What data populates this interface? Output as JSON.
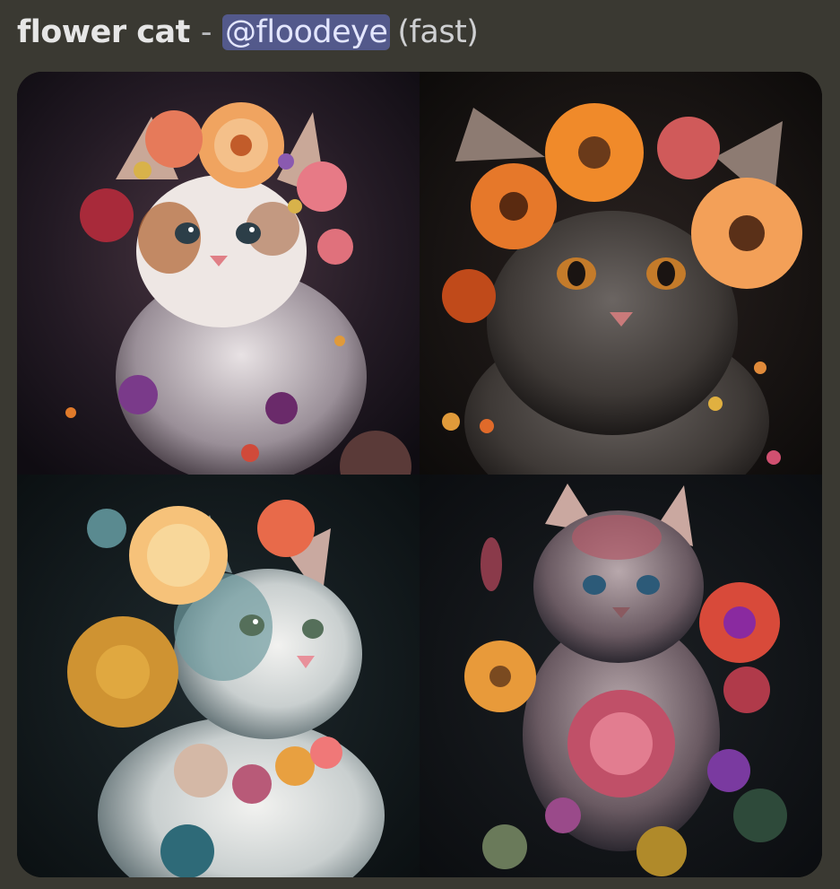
{
  "message": {
    "prompt": "flower cat",
    "separator": "-",
    "mention": "@floodeye",
    "mode": "(fast)"
  },
  "images": [
    {
      "name": "flower-cat-image-1",
      "subject": "calico kitten with pink and orange flower crown"
    },
    {
      "name": "flower-cat-image-2",
      "subject": "dark grey kitten with orange daisies"
    },
    {
      "name": "flower-cat-image-3",
      "subject": "white and teal cat with peach and mustard flowers"
    },
    {
      "name": "flower-cat-image-4",
      "subject": "fluffy kitten with red gerbera and pink flowers"
    }
  ],
  "colors": {
    "background": "#3a3932",
    "mention_bg": "#5b63a8",
    "text": "#e6e6e6"
  }
}
